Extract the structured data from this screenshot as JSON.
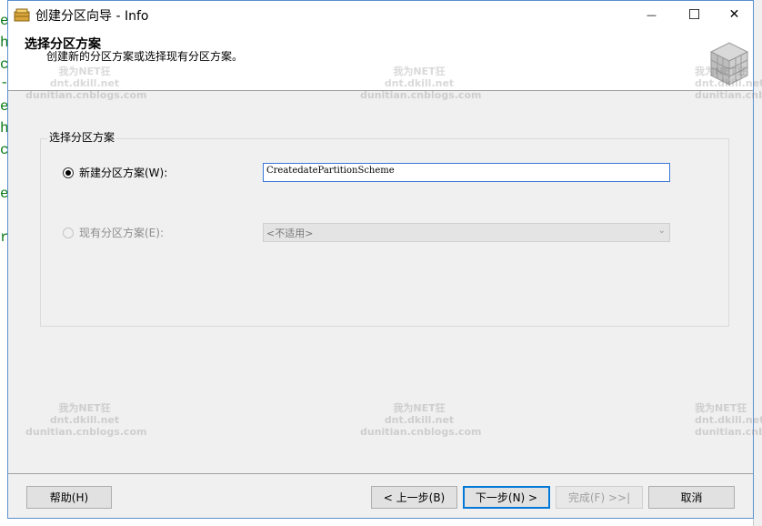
{
  "window": {
    "title": "创建分区向导 - Info",
    "minimize_glyph": "—",
    "maximize_glyph": "☐",
    "close_glyph": "✕"
  },
  "header": {
    "title": "选择分区方案",
    "subtitle": "创建新的分区方案或选择现有分区方案。"
  },
  "group": {
    "title": "选择分区方案",
    "new_scheme_label": "新建分区方案(W):",
    "new_scheme_value": "CreatedatePartitionScheme",
    "existing_scheme_label": "现有分区方案(E):",
    "existing_scheme_value": "<不适用>",
    "selected": "new"
  },
  "buttons": {
    "help": "帮助(H)",
    "back": "< 上一步(B)",
    "next": "下一步(N) >",
    "finish": "完成(F) >>|",
    "cancel": "取消"
  },
  "watermark": {
    "line1": "我为NET狂",
    "line2": "dnt.dkill.net",
    "line3": "dunitian.cnblogs.com"
  },
  "background_left_glyphs": [
    "e",
    "h",
    "c",
    "-",
    "e",
    "h",
    "c",
    "e",
    "r"
  ]
}
